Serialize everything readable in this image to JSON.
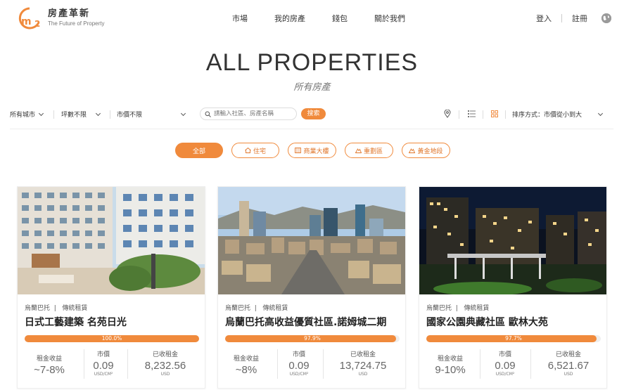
{
  "brand": {
    "title": "房產革新",
    "subtitle": "The Future of Property",
    "accent": "#f08a3c"
  },
  "nav": [
    "市場",
    "我的房產",
    "錢包",
    "關於我們"
  ],
  "auth": {
    "login": "登入",
    "register": "註冊"
  },
  "hero": {
    "title": "ALL PROPERTIES",
    "subtitle": "所有房產"
  },
  "filters": {
    "city": "所有城市",
    "area": "坪數不限",
    "price": "市價不限",
    "search_placeholder": "請輸入社區、房產名稱",
    "search_button": "搜索",
    "sort_label": "排序方式：",
    "sort_value": "市價從小到大"
  },
  "categories": [
    {
      "label": "全部",
      "icon": "",
      "active": true
    },
    {
      "label": "住宅",
      "icon": "house-icon",
      "active": false
    },
    {
      "label": "商業大樓",
      "icon": "building-icon",
      "active": false
    },
    {
      "label": "重劃區",
      "icon": "mountain-icon",
      "active": false
    },
    {
      "label": "黃金地段",
      "icon": "mountain-icon",
      "active": false
    }
  ],
  "cards": [
    {
      "city": "烏蘭巴托",
      "type": "傳統租賃",
      "title": "日式工藝建築 名苑日光",
      "progress": 100.0,
      "progress_label": "100.0%",
      "yield_label": "租金收益",
      "yield": "~7-8%",
      "price_label": "市價",
      "price": "0.09",
      "price_unit": "USD/CM²",
      "rent_label": "已收租金",
      "rent": "8,232.56",
      "rent_unit": "USD"
    },
    {
      "city": "烏蘭巴托",
      "type": "傳統租賃",
      "title": "烏蘭巴托高收益優質社區.諾姆城二期",
      "progress": 97.9,
      "progress_label": "97.9%",
      "yield_label": "租金收益",
      "yield": "~8%",
      "price_label": "市價",
      "price": "0.09",
      "price_unit": "USD/CM²",
      "rent_label": "已收租金",
      "rent": "13,724.75",
      "rent_unit": "USD"
    },
    {
      "city": "烏蘭巴托",
      "type": "傳統租賃",
      "title": "國家公園典藏社區 歐林大苑",
      "progress": 97.7,
      "progress_label": "97.7%",
      "yield_label": "租金收益",
      "yield": "9-10%",
      "price_label": "市價",
      "price": "0.09",
      "price_unit": "USD/CM²",
      "rent_label": "已收租金",
      "rent": "6,521.67",
      "rent_unit": "USD"
    }
  ]
}
